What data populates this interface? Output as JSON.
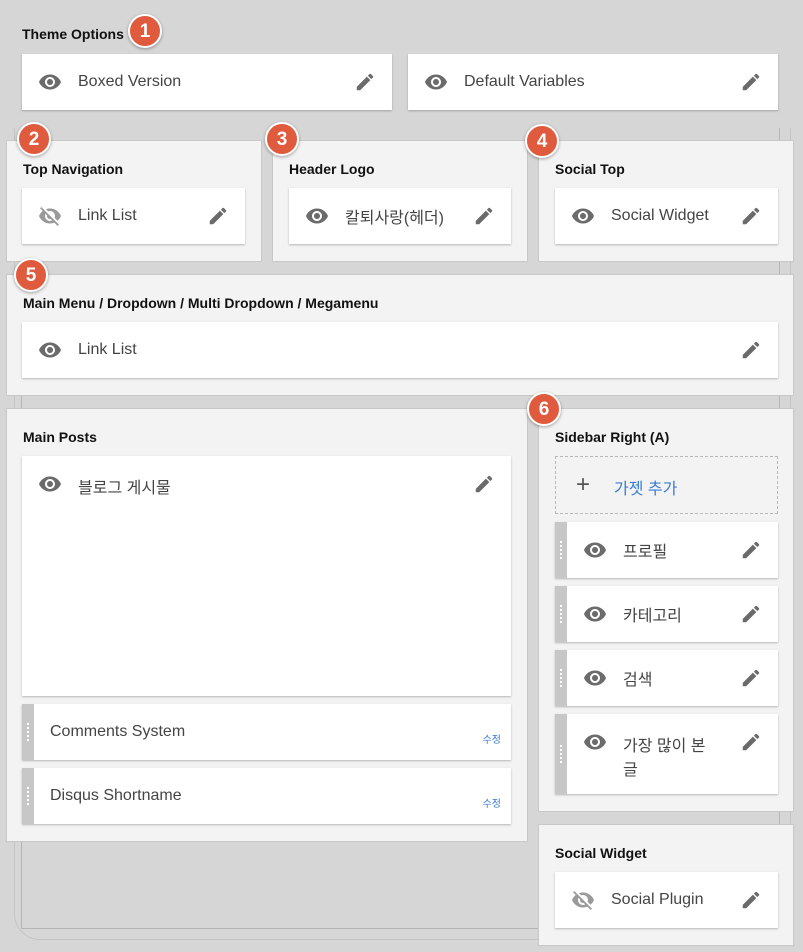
{
  "badges": [
    "1",
    "2",
    "3",
    "4",
    "5",
    "6"
  ],
  "theme_options": {
    "title": "Theme Options",
    "boxed": "Boxed Version",
    "default_vars": "Default Variables"
  },
  "top_navigation": {
    "title": "Top Navigation",
    "widget": "Link List",
    "widget_hidden": true
  },
  "header_logo": {
    "title": "Header Logo",
    "widget": "칼퇴사랑(헤더)"
  },
  "social_top": {
    "title": "Social Top",
    "widget": "Social Widget"
  },
  "main_menu": {
    "title": "Main Menu / Dropdown / Multi Dropdown / Megamenu",
    "widget": "Link List"
  },
  "main_posts": {
    "title": "Main Posts",
    "blog_widget": "블로그 게시물",
    "items": [
      {
        "label": "Comments System",
        "edit": "수정"
      },
      {
        "label": "Disqus Shortname",
        "edit": "수정"
      }
    ]
  },
  "sidebar_right": {
    "title": "Sidebar Right (A)",
    "add_label": "가젯 추가",
    "items": [
      {
        "label": "프로필"
      },
      {
        "label": "카테고리"
      },
      {
        "label": "검색"
      },
      {
        "label_line1": "가장 많이 본",
        "label_line2": "글"
      }
    ]
  },
  "social_widget_section": {
    "title": "Social Widget",
    "widget": "Social Plugin",
    "widget_hidden": true
  },
  "colors": {
    "badge": "#e05a3d",
    "link": "#3a7bd5",
    "icon": "#6b6b6b"
  }
}
